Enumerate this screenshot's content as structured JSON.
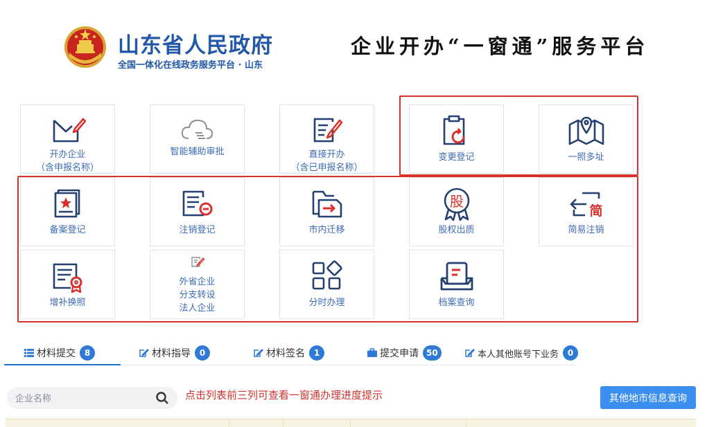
{
  "header": {
    "gov_name": "山东省人民政府",
    "gov_subtitle": "全国一体化在线政务服务平台 · 山东",
    "platform_title": "企业开办“一窗通”服务平台"
  },
  "tiles": [
    {
      "label": "开办企业\n（含申报名称）",
      "icon": "envelope-pen-icon"
    },
    {
      "label": "智能辅助审批",
      "icon": "cloud-icon"
    },
    {
      "label": "直接开办\n（含已申报名称）",
      "icon": "document-pen-icon"
    },
    {
      "label": "变更登记",
      "icon": "clipboard-refresh-icon"
    },
    {
      "label": "一照多址",
      "icon": "map-pin-icon"
    },
    {
      "label": "备案登记",
      "icon": "star-card-icon"
    },
    {
      "label": "注销登记",
      "icon": "document-minus-icon"
    },
    {
      "label": "市内迁移",
      "icon": "folder-arrow-icon"
    },
    {
      "label": "股权出质",
      "icon": "equity-badge-icon",
      "glyph": "股"
    },
    {
      "label": "简易注销",
      "icon": "simple-cancel-icon",
      "glyph": "简"
    },
    {
      "label": "增补换照",
      "icon": "certificate-icon"
    },
    {
      "label": "外省企业\n分支转设\n法人企业",
      "icon": "small-pen-icon"
    },
    {
      "label": "分时办理",
      "icon": "grid-diamond-icon"
    },
    {
      "label": "档案查询",
      "icon": "archive-tray-icon"
    }
  ],
  "tabs": [
    {
      "label": "材料提交",
      "count": "8",
      "icon": "list-icon"
    },
    {
      "label": "材料指导",
      "count": "0",
      "icon": "edit-icon"
    },
    {
      "label": "材料签名",
      "count": "1",
      "icon": "edit-icon"
    },
    {
      "label": "提交申请",
      "count": "50",
      "icon": "briefcase-icon"
    },
    {
      "label": "本人其他账号下业务",
      "count": "0",
      "icon": "edit-icon"
    }
  ],
  "search": {
    "placeholder": "企业名称"
  },
  "hint": "点击列表前三列可查看一窗通办理进度提示",
  "other_city_button": "其他地市信息查询",
  "colors": {
    "primary": "#2258a8",
    "accent_red": "#d9302c",
    "badge": "#2e7ad6",
    "button": "#3b8ff0"
  }
}
